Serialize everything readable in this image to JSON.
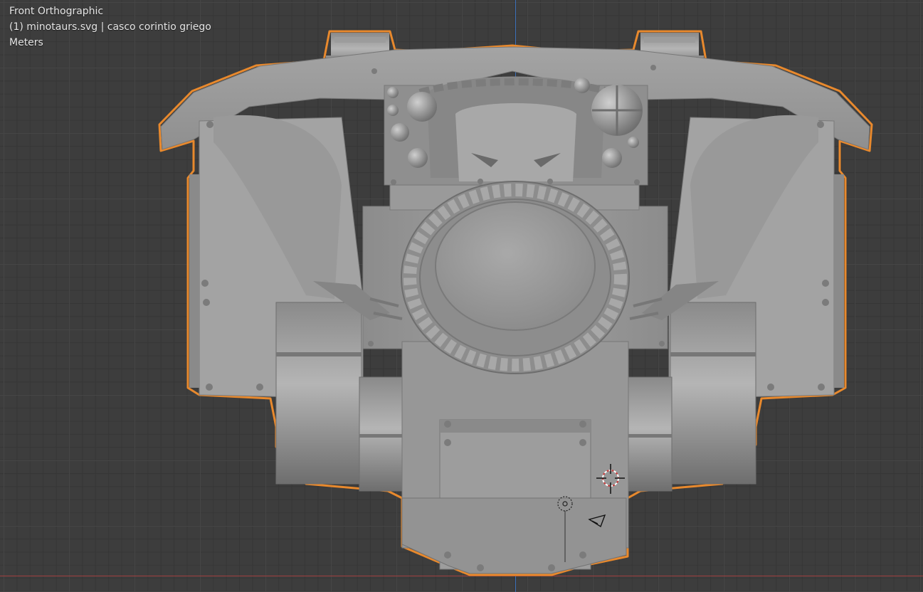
{
  "viewport": {
    "view_name": "Front Orthographic",
    "active_object": "(1) minotaurs.svg | casco corintio griego",
    "units": "Meters"
  },
  "colors": {
    "background": "#3d3d3d",
    "grid_major": "#464646",
    "grid_minor": "#363636",
    "axis_z": "#3a6fb8",
    "axis_x": "#a04040",
    "selection_outline": "#e8892d",
    "model_base": "#9a9a9a",
    "model_light": "#b2b2b2",
    "model_shadow": "#6a6a6a"
  },
  "icons": {
    "cursor": "3d-cursor-icon",
    "camera": "camera-icon",
    "light": "light-icon"
  }
}
